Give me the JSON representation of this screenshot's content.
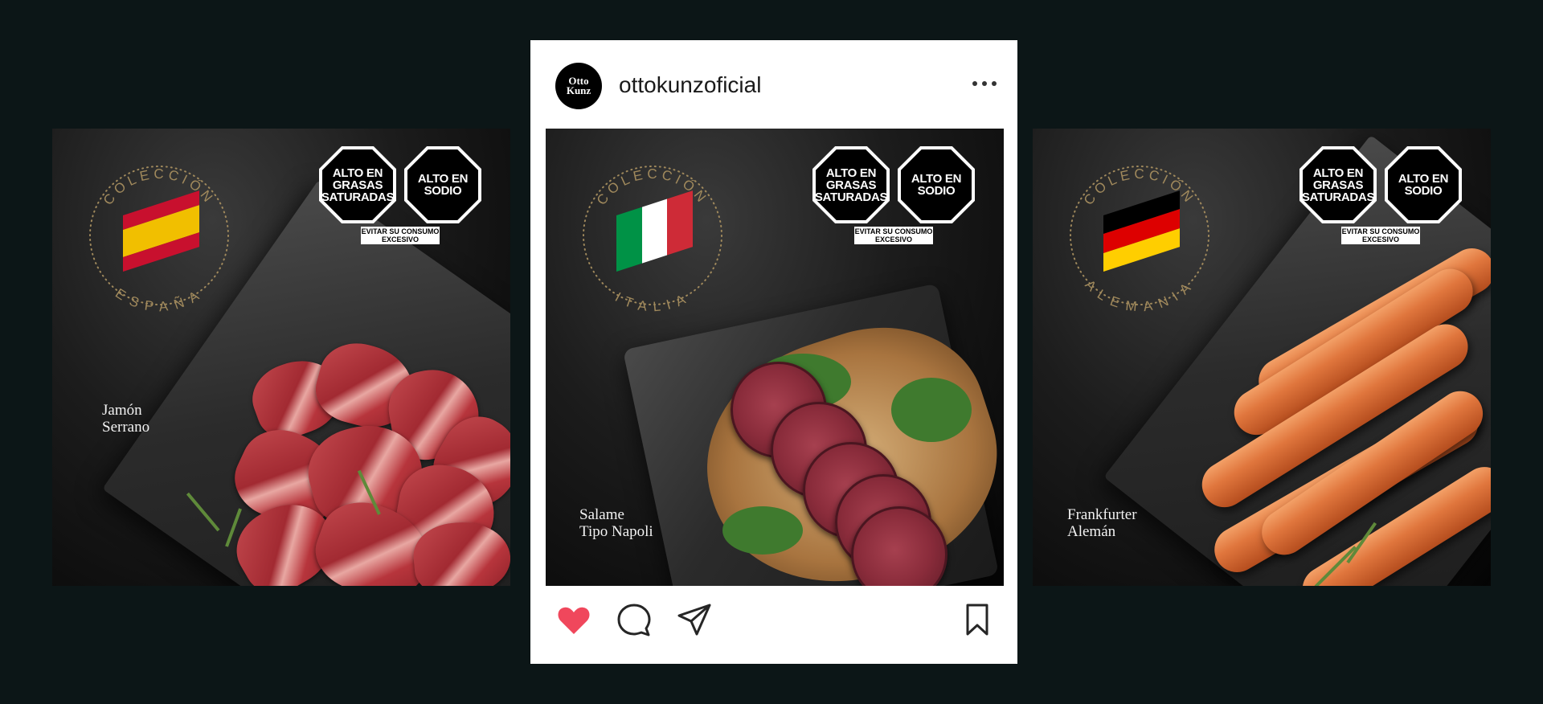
{
  "instagram": {
    "username": "ottokunzoficial",
    "avatar_text": "Otto\nKunz",
    "actions": [
      "heart-icon",
      "comment-icon",
      "share-icon",
      "bookmark-icon"
    ],
    "liked_color": "#f0475c"
  },
  "warnings": {
    "octagon_1": "ALTO EN GRASAS SATURADAS",
    "octagon_2": "ALTO EN SODIO",
    "caption": "EVITAR SU CONSUMO EXCESIVO"
  },
  "posts": [
    {
      "collection_label": "COLECCIÓN",
      "country": "ESPAÑA",
      "product": "Jamón\nSerrano",
      "flag_colors": [
        "#c8102e",
        "#f1bf00",
        "#c8102e"
      ]
    },
    {
      "collection_label": "COLECCIÓN",
      "country": "ITALIA",
      "product": "Salame\nTipo Napoli",
      "flag_colors": [
        "#009246",
        "#ffffff",
        "#ce2b37"
      ]
    },
    {
      "collection_label": "COLECCIÓN",
      "country": "ALEMANIA",
      "product": "Frankfurter\nAlemán",
      "flag_colors": [
        "#000000",
        "#dd0000",
        "#ffce00"
      ]
    }
  ],
  "colors": {
    "background": "#0c1617",
    "seal_gold": "#a0895c"
  }
}
